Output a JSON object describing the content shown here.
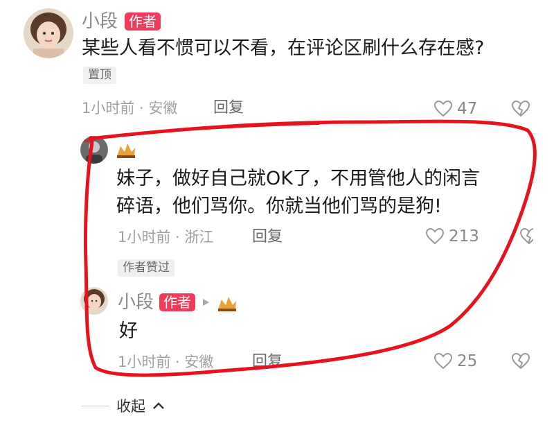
{
  "top_comment": {
    "username": "小段",
    "author_badge": "作者",
    "text": "某些人看不惯可以不看，在评论区刷什么存在感?",
    "pinned_tag": "置顶",
    "time_location": "1小时前 · 安徽",
    "reply_label": "回复",
    "like_count": "47"
  },
  "reply_1": {
    "text_line1": "妹子，做好自己就OK了，不用管他人的闲言",
    "text_line2": "碎语，他们骂你。你就当他们骂的是狗!",
    "time_location": "1小时前 · 浙江",
    "reply_label": "回复",
    "like_count": "213",
    "author_liked_tag": "作者赞过"
  },
  "reply_2": {
    "username": "小段",
    "author_badge": "作者",
    "text": "好",
    "time_location": "1小时前 · 安徽",
    "reply_label": "回复",
    "like_count": "25"
  },
  "collapse_label": "收起",
  "colors": {
    "author_badge": "#f03c5a",
    "annotation": "#e8121f"
  },
  "icons": [
    "heart-outline-icon",
    "broken-heart-icon",
    "play-arrow-icon",
    "chevron-up-icon"
  ]
}
